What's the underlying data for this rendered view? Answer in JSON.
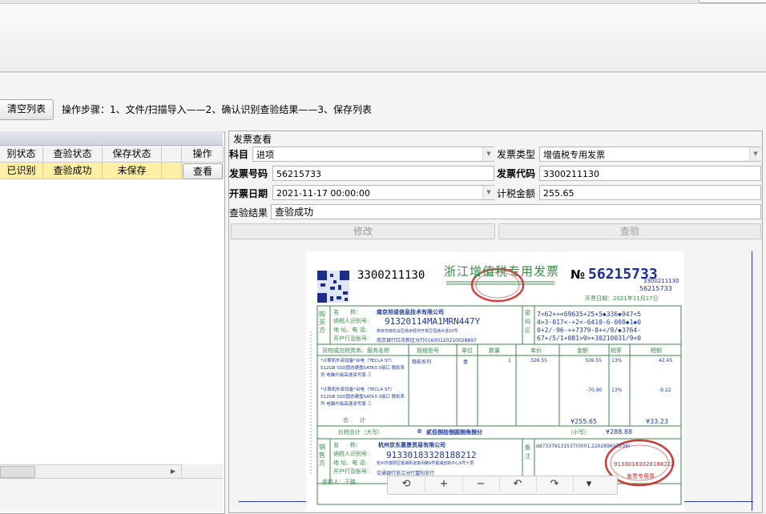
{
  "toolbar": {
    "clear_label": "清空列表",
    "steps": "操作步骤：1、文件/扫描导入——2、确认识别查验结果——3、保存列表"
  },
  "table": {
    "columns": [
      "别状态",
      "查验状态",
      "保存状态",
      "",
      "操作"
    ],
    "rows": [
      {
        "recog": "已识别",
        "check": "查验成功",
        "save": "未保存",
        "action": "查看"
      }
    ]
  },
  "detail": {
    "title": "发票查看",
    "subject_label": "科目",
    "subject_value": "进项",
    "type_label": "发票类型",
    "type_value": "增值税专用发票",
    "number_label": "发票号码",
    "number_value": "56215733",
    "code_label": "发票代码",
    "code_value": "3300211130",
    "date_label": "开票日期",
    "date_value": "2021-11-17 00:00:00",
    "tax_label": "计税金额",
    "tax_value": "255.65",
    "result_label": "查验结果",
    "result_value": "查验成功",
    "modify_label": "修改",
    "check_label": "查验"
  },
  "invoice": {
    "code": "3300211130",
    "title": "浙江增值税专用发票",
    "no_mark": "№",
    "no_big": "56215733",
    "no_small_code": "3300211130",
    "no_small_num": "56215733",
    "issue_date": "开票日期：2021年11月17日",
    "buyer_name": "南京旭诺信息技术有限公司",
    "buyer_taxid": "91320114MA1MRN447Y",
    "buyer_addr": "南京市雨花台区南京经济开发区恒通大道10号",
    "buyer_bank": "南京银行红花新区分行01600120210028697",
    "cipher1": "7<62+><69635+25+5◆336◆947<5",
    "cipher2": "4>3-017<-+2<-6410-6-008◆1◆0",
    "cipher3": "0+2/-96-++7379-8+</9/◆3764-",
    "cipher4": "67+/5/1+081>9>+30210031/9<0",
    "col_item": "货物或应税劳务、服务名称",
    "col_spec": "规格型号",
    "col_unit": "单位",
    "col_qty": "数量",
    "col_price": "单价",
    "col_amount": "金额",
    "col_rate": "税率",
    "col_tax": "税额",
    "item1": "*计算机外部设备*台电（TECLA ST）512GB SSD固态硬盘SATA3.0接口 稳影系列 电脑升级高速读写版 三",
    "item1_spec": "稳影系列",
    "item1_unit": "盒",
    "item1_qty": "1",
    "item1_price": "326.55",
    "item1_amount": "326.55",
    "item1_rate": "13%",
    "item1_tax": "42.45",
    "item2": "*计算机外部设备*台电（TECLA ST）512GB SSD固态硬盘SATA3.0接口 稳影系列 电脑升级高速读写版 三",
    "item2_amount": "-70.90",
    "item2_rate": "13%",
    "item2_tax": "-9.22",
    "total_label": "合　　计",
    "total_amount": "¥255.65",
    "total_tax": "¥33.23",
    "sum_label": "价税合计（大写）",
    "sum_words": "贰佰捌拾捌圆捌角捌分",
    "sum_small_label": "（小写）",
    "sum_small": "¥288.88",
    "seller_name": "杭州京东惠景贸易有限公司",
    "seller_taxid": "91330183328188212",
    "seller_addr": "杭州市富阳区银湖街道富闲路9号银湖创新中心9号十层",
    "seller_bank": "交通银行浙江分行富阳支行",
    "remark": "dd73379131537(0001,220289657236)",
    "payee": "收款人：王鹏",
    "stamp_id": "91330183328188212",
    "stamp_text": "发票专用章"
  },
  "zoom_icons": [
    "reset-icon",
    "zoom-in-icon",
    "zoom-out-icon",
    "rotate-left-icon",
    "rotate-right-icon",
    "more-icon"
  ],
  "zoom_glyphs": [
    "⟲",
    "+",
    "−",
    "↶",
    "↷",
    "▾"
  ]
}
